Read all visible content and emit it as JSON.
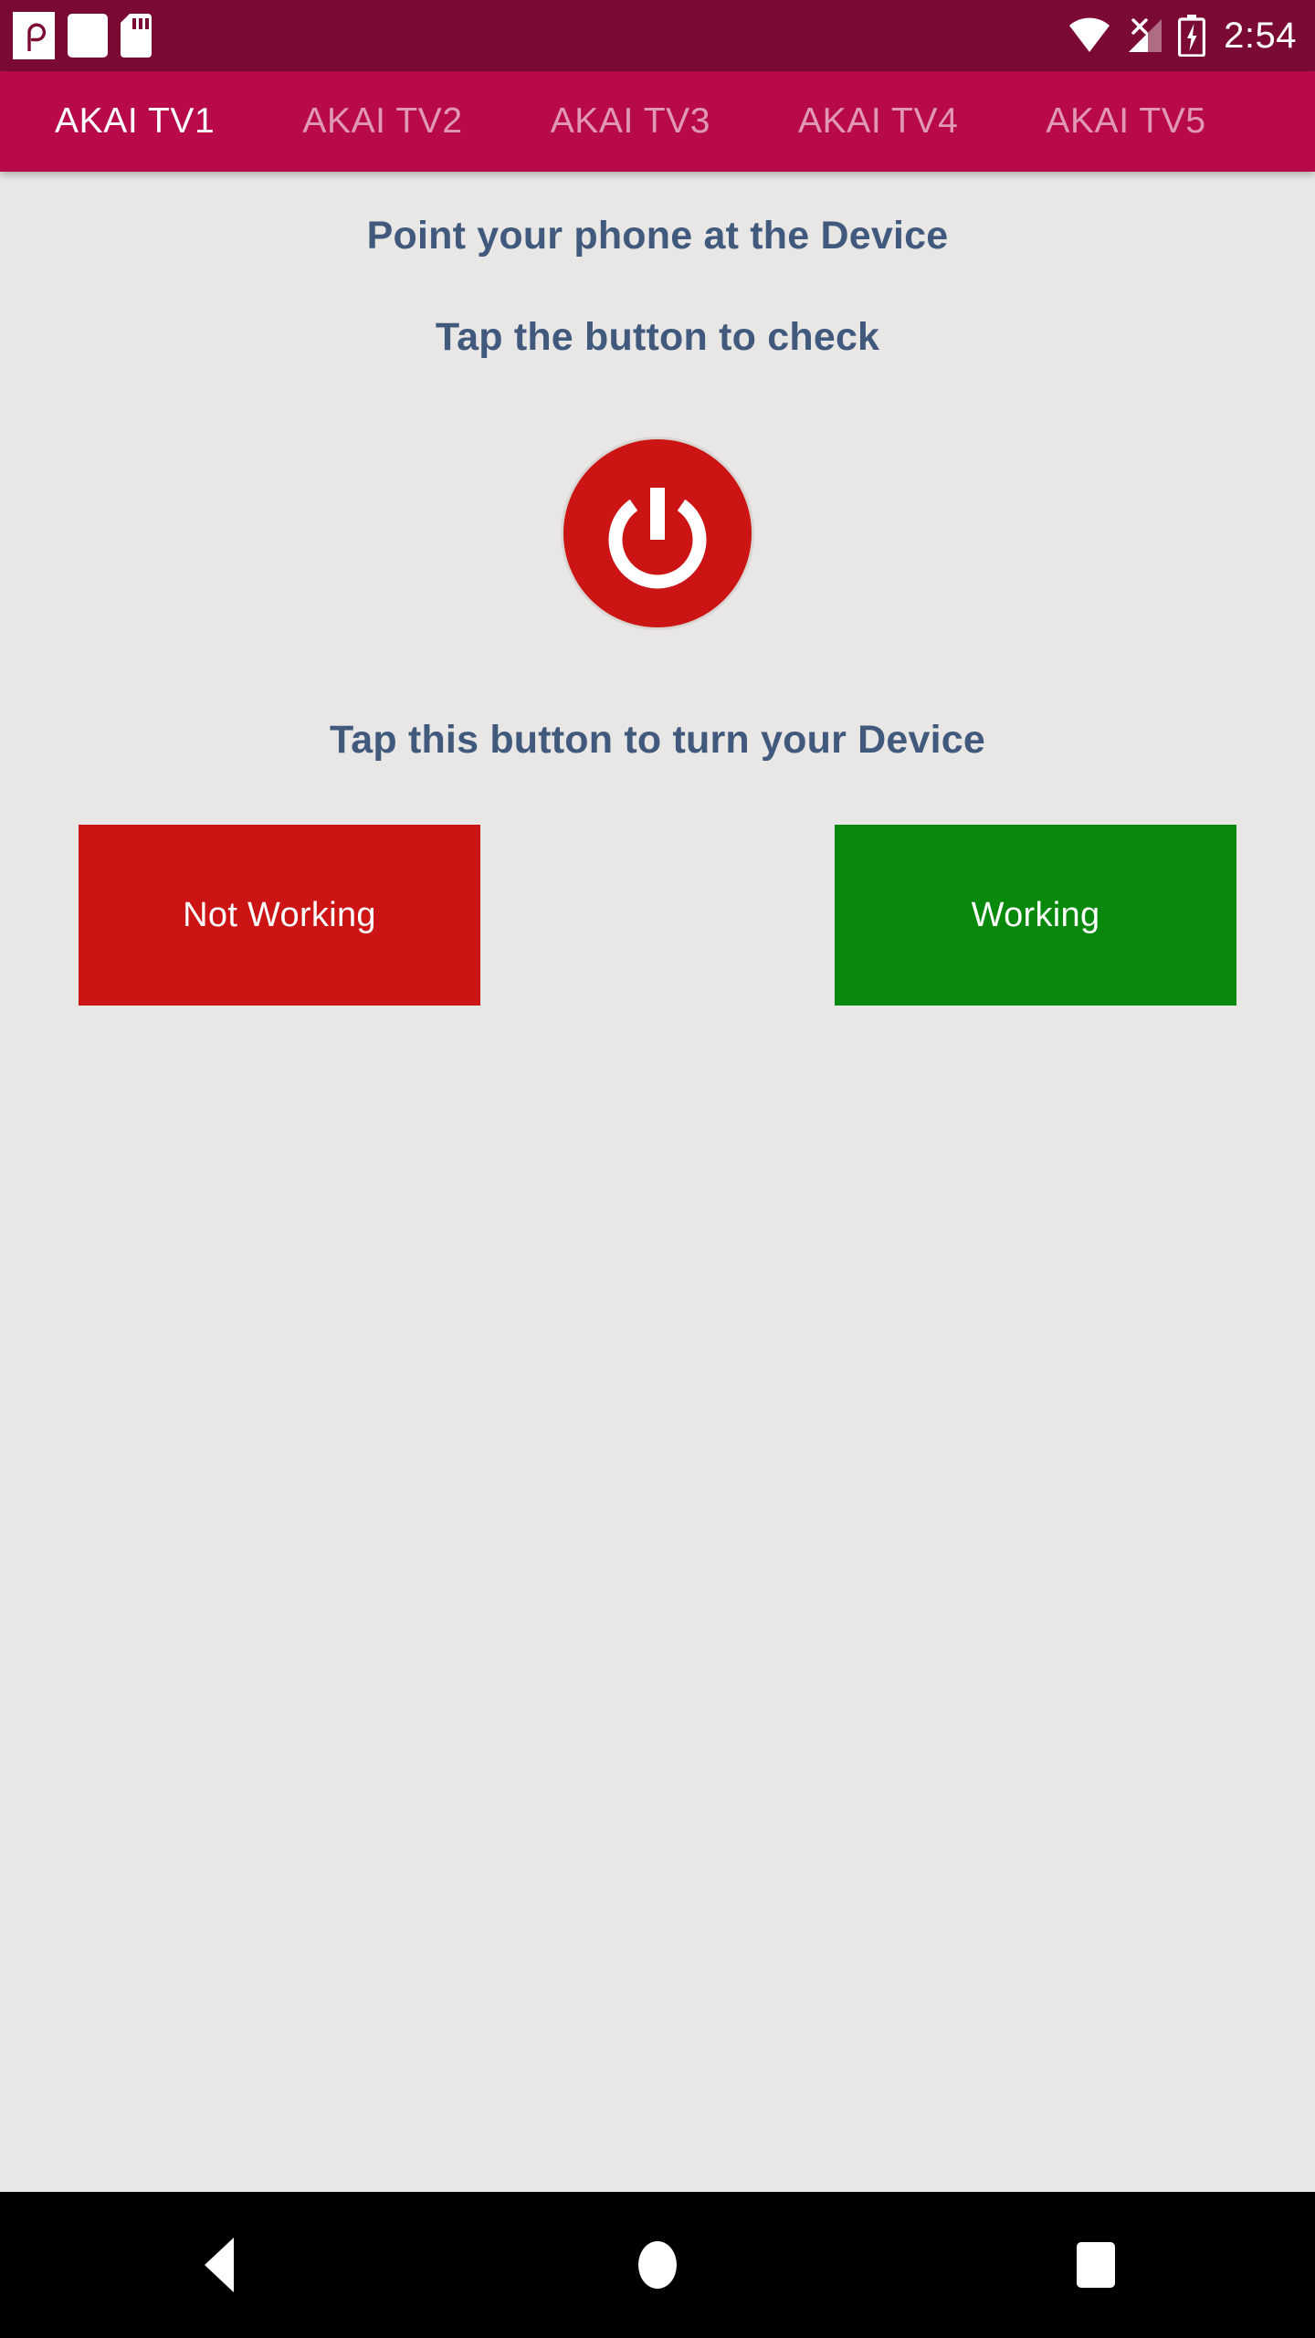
{
  "status_bar": {
    "time": "2:54",
    "background_color": "#7A0A33",
    "left_icons": [
      {
        "name": "app-notification-icon",
        "glyph": "P"
      },
      {
        "name": "blank-notification-icon",
        "glyph": ""
      },
      {
        "name": "sd-card-icon",
        "glyph": "sd"
      }
    ],
    "right_icons": [
      {
        "name": "wifi-icon",
        "label": "wifi-full"
      },
      {
        "name": "cellular-no-sim-icon",
        "label": "no-signal"
      },
      {
        "name": "battery-charging-icon",
        "label": "charging"
      }
    ]
  },
  "tab_bar": {
    "background_color": "#B80A4B",
    "active_index": 0,
    "tabs": [
      {
        "label": "AKAI TV1",
        "active": true
      },
      {
        "label": "AKAI TV2",
        "active": false
      },
      {
        "label": "AKAI TV3",
        "active": false
      },
      {
        "label": "AKAI TV4",
        "active": false
      },
      {
        "label": "AKAI TV5",
        "active": false
      }
    ]
  },
  "content": {
    "background_color": "#E8E7E5",
    "heading_color": "#41597C",
    "instruction_1": "Point your phone at the Device",
    "instruction_2": "Tap the button to check",
    "power_button": {
      "name": "power-button",
      "color": "#CC1414",
      "icon": "power-icon"
    },
    "caption": "Tap this button to turn your Device",
    "actions": [
      {
        "label": "Not Working",
        "color": "#CC1414",
        "name": "not-working-button"
      },
      {
        "label": "Working",
        "color": "#08890C",
        "name": "working-button"
      }
    ]
  },
  "nav_bar": {
    "background_color": "#000000",
    "buttons": [
      {
        "name": "nav-back-button",
        "label": "Back"
      },
      {
        "name": "nav-home-button",
        "label": "Home"
      },
      {
        "name": "nav-recents-button",
        "label": "Recents"
      }
    ]
  }
}
